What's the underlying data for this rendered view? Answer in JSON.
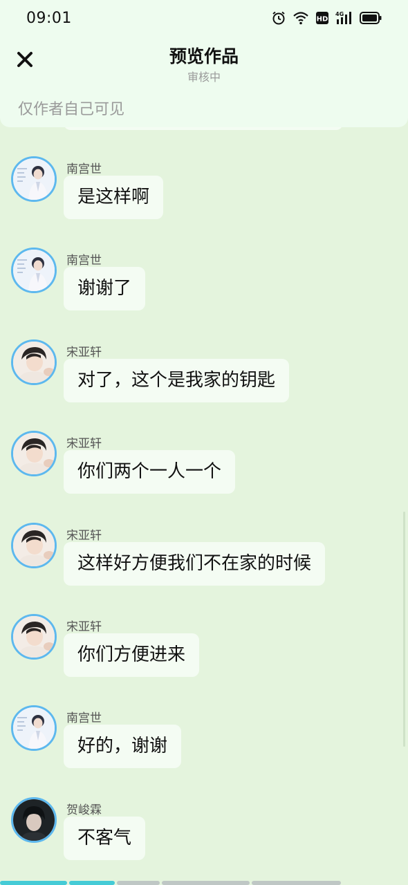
{
  "status_bar": {
    "time": "09:01",
    "hd_badge": "HD",
    "network": "4G"
  },
  "nav": {
    "title": "预览作品",
    "subtitle": "审核中",
    "close_icon": "close-icon"
  },
  "visibility_note": "仅作者自己可见",
  "messages": [
    {
      "sender": "南宫世",
      "text": "是这样啊"
    },
    {
      "sender": "南宫世",
      "text": "谢谢了"
    },
    {
      "sender": "宋亚轩",
      "text": "对了，这个是我家的钥匙"
    },
    {
      "sender": "宋亚轩",
      "text": "你们两个一人一个"
    },
    {
      "sender": "宋亚轩",
      "text": "这样好方便我们不在家的时候"
    },
    {
      "sender": "宋亚轩",
      "text": "你们方便进来"
    },
    {
      "sender": "南宫世",
      "text": "好的，谢谢"
    },
    {
      "sender": "贺峻霖",
      "text": "不客气"
    }
  ],
  "progress": {
    "played_fraction": 0.28
  },
  "colors": {
    "background": "#e4f4dd",
    "header": "#eefcef",
    "bubble": "#f4fcf3",
    "avatar_border": "#5db8ee",
    "progress_active": "#45cbd6"
  }
}
